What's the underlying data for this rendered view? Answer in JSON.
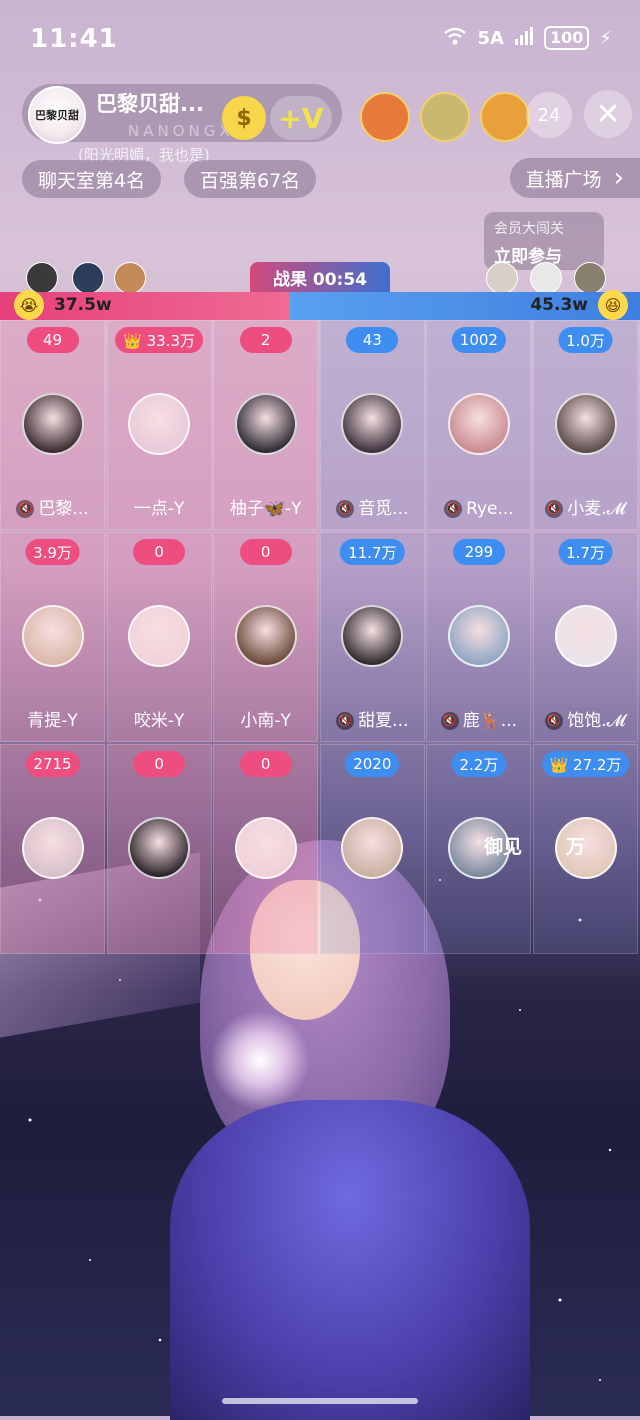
{
  "status_bar": {
    "time": "11:41",
    "network": "5A",
    "battery": "100"
  },
  "host": {
    "name": "巴黎贝甜...",
    "avatar_text": "巴黎贝甜",
    "sub": "(阳光明媚，我也是)"
  },
  "watermark": "NANONGXIN",
  "buttons": {
    "v_label": "+V",
    "viewer_count": "24",
    "close": "✕"
  },
  "tags": {
    "chatroom_rank": "聊天室第4名",
    "top100_rank": "百强第67名",
    "plaza": "直播广场",
    "plaza_arrow": "›"
  },
  "member_challenge": {
    "line1": "会员大闯关",
    "line2": "立即参与"
  },
  "battle": {
    "label": "战果 00:54",
    "left_score": "37.5w",
    "right_score": "45.3w",
    "left_share": 0.453,
    "colors": {
      "left": "#ee4d7f",
      "right": "#3e8df0"
    }
  },
  "seats": [
    {
      "badge": "49",
      "name": "巴黎...",
      "team": "red",
      "muted": true
    },
    {
      "badge": "👑 33.3万",
      "name": "一点-Y",
      "team": "red",
      "muted": false
    },
    {
      "badge": "2",
      "name": "柚子🦋-Y",
      "team": "red",
      "muted": false
    },
    {
      "badge": "43",
      "name": "音觅...",
      "team": "blue",
      "muted": true
    },
    {
      "badge": "1002",
      "name": "Rye...",
      "team": "blue",
      "muted": true
    },
    {
      "badge": "1.0万",
      "name": "小麦.𝓜",
      "team": "blue",
      "muted": true
    },
    {
      "badge": "3.9万",
      "name": "青提-Y",
      "team": "red",
      "muted": false
    },
    {
      "badge": "0",
      "name": "咬米-Y",
      "team": "red",
      "muted": false
    },
    {
      "badge": "0",
      "name": "小南-Y",
      "team": "red",
      "muted": false
    },
    {
      "badge": "11.7万",
      "name": "甜夏...",
      "team": "blue",
      "muted": true
    },
    {
      "badge": "299",
      "name": "鹿🦌...",
      "team": "blue",
      "muted": true
    },
    {
      "badge": "1.7万",
      "name": "饱饱.𝓜",
      "team": "blue",
      "muted": true
    },
    {
      "badge": "2715",
      "name": "",
      "team": "red",
      "muted": false
    },
    {
      "badge": "0",
      "name": "",
      "team": "red",
      "muted": false
    },
    {
      "badge": "0",
      "name": "",
      "team": "red",
      "muted": false
    },
    {
      "badge": "2020",
      "name": "",
      "team": "blue",
      "muted": false
    },
    {
      "badge": "2.2万",
      "name": "",
      "team": "blue",
      "muted": false
    },
    {
      "badge": "👑 27.2万",
      "name": "",
      "team": "blue",
      "muted": false
    }
  ],
  "overlay_text": {
    "yujian": "御见",
    "wan": "万"
  },
  "avatar_colors": [
    "#3a2a30",
    "#e8c9d8",
    "#2c2832",
    "#3b2f3a",
    "#c98a8f",
    "#5a4a4a",
    "#d9b8a8",
    "#f1d2d8",
    "#6b4a3a",
    "#2e2a2e",
    "#8fa6c2",
    "#e8e4ea",
    "#d8c0c8",
    "#2a2228",
    "#f0d0d8",
    "#c8b0a0",
    "#7a8aa0",
    "#e0c8b8"
  ],
  "icons": [
    "wifi-icon",
    "signal-icon",
    "battery-icon",
    "coin-icon",
    "close-icon",
    "chevron-right-icon",
    "mute-icon",
    "crown-icon",
    "emoji-icon"
  ]
}
